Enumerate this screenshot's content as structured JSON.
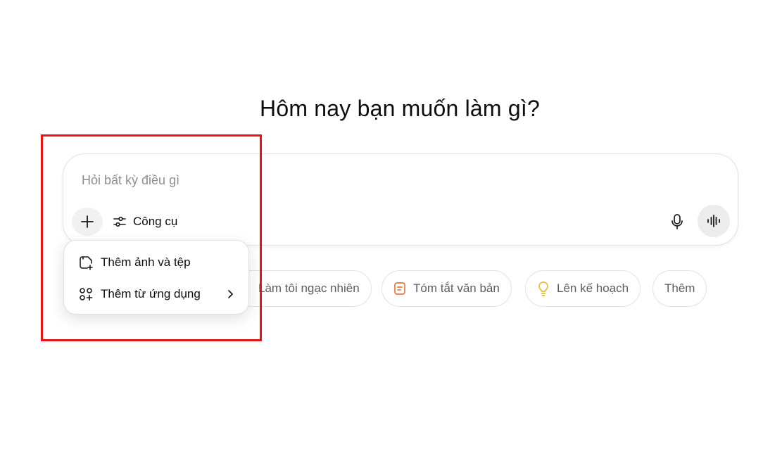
{
  "heading": "Hôm nay bạn muốn làm gì?",
  "composer": {
    "placeholder": "Hỏi bất kỳ điều gì",
    "tools_label": "Công cụ",
    "plus_icon": "plus-icon",
    "tools_icon": "sliders-icon",
    "mic_icon": "microphone-icon",
    "voice_icon": "voice-waveform-icon"
  },
  "attach_menu": {
    "items": [
      {
        "label": "Thêm ảnh và tệp",
        "icon": "attach-file-icon"
      },
      {
        "label": "Thêm từ ứng dụng",
        "icon": "apps-icon",
        "submenu_icon": "chevron-right-icon"
      }
    ]
  },
  "suggestions": [
    {
      "label": "Làm tôi ngạc nhiên",
      "icon": ""
    },
    {
      "label": "Tóm tắt văn bản",
      "icon": "document-icon",
      "icon_color": "#e8793a"
    },
    {
      "label": "Lên kế hoạch",
      "icon": "lightbulb-icon",
      "icon_color": "#e2b93b"
    },
    {
      "label": "Thêm",
      "icon": ""
    }
  ],
  "colors": {
    "highlight_border": "#ee1111",
    "button_gray": "#f1f1f1",
    "voice_button": "#ececec"
  }
}
